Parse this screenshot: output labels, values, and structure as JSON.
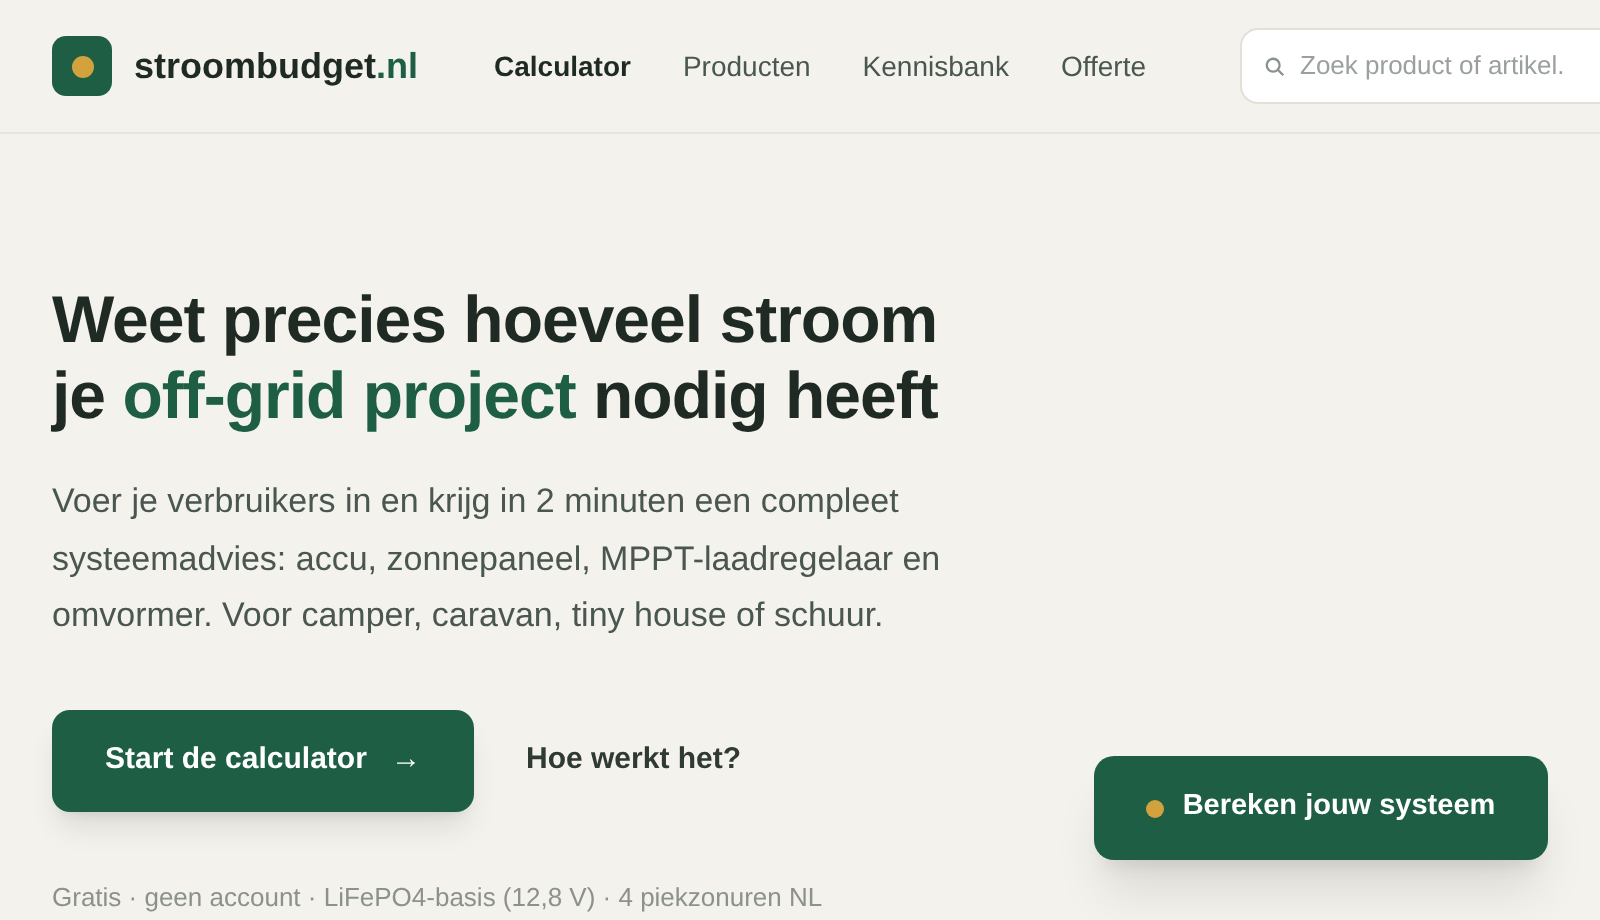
{
  "brand": {
    "name": "stroombudget",
    "tld": ".nl"
  },
  "nav": [
    {
      "label": "Calculator",
      "selected": true
    },
    {
      "label": "Producten",
      "selected": false
    },
    {
      "label": "Kennisbank",
      "selected": false
    },
    {
      "label": "Offerte",
      "selected": false
    }
  ],
  "search": {
    "placeholder": "Zoek product of artikel."
  },
  "hero": {
    "title_before": "Weet precies hoeveel stroom je ",
    "title_highlight": "off-grid project",
    "title_after": " nodig heeft",
    "intro": "Voer je verbruikers in en krijg in 2 minuten een compleet systeemadvies: accu, zonnepaneel, MPPT-laadregelaar en omvormer. Voor camper, caravan, tiny house of schuur.",
    "primary_button": "Start de calculator",
    "primary_arrow": "→",
    "secondary_link": "Hoe werkt het?",
    "footnote": "Gratis · geen account · LiFePO4-basis (12,8 V) · 4 piekzonuren NL"
  },
  "floating_button": "Bereken jouw systeem"
}
